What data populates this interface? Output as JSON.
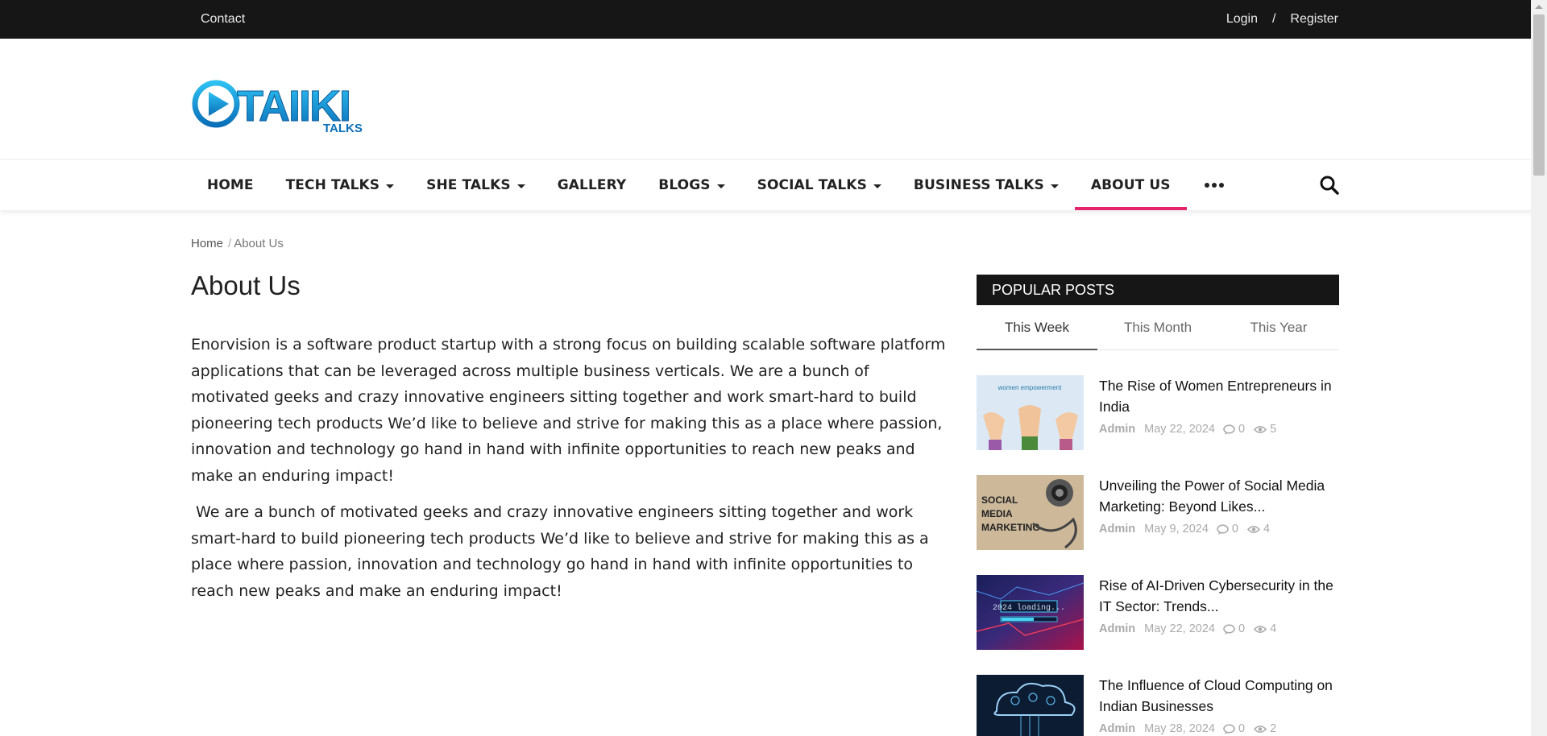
{
  "topbar": {
    "contact": "Contact",
    "login": "Login",
    "separator": "/",
    "register": "Register"
  },
  "logo": {
    "main_text": "TAIIKI",
    "sub_text": "TALKS"
  },
  "nav": {
    "items": [
      {
        "label": "HOME",
        "dropdown": false
      },
      {
        "label": "TECH TALKS",
        "dropdown": true
      },
      {
        "label": "SHE TALKS",
        "dropdown": true
      },
      {
        "label": "GALLERY",
        "dropdown": false
      },
      {
        "label": "BLOGS",
        "dropdown": true
      },
      {
        "label": "SOCIAL TALKS",
        "dropdown": true
      },
      {
        "label": "BUSINESS TALKS",
        "dropdown": true
      },
      {
        "label": "ABOUT US",
        "dropdown": false,
        "active": true
      }
    ],
    "accent_color": "#e6246e"
  },
  "breadcrumb": {
    "home": "Home",
    "separator": "/",
    "current": "About Us"
  },
  "page": {
    "title": "About Us",
    "paragraphs": [
      "Enorvision is a software product startup with a strong focus on building scalable software platform applications that can be leveraged across multiple business verticals. We are a bunch of motivated geeks and crazy innovative engineers sitting together and work smart-hard to build pioneering tech products We’d like to believe and strive for making this as a place where passion, innovation and technology go hand in hand with infinite opportunities to reach new peaks and make an enduring impact!",
      " We are a bunch of motivated geeks and crazy innovative engineers sitting together and work smart-hard to build pioneering tech products We’d like to believe and strive for making this as a place where passion, innovation and technology go hand in hand with infinite opportunities to reach new peaks and make an enduring impact!"
    ]
  },
  "sidebar": {
    "widget_title": "POPULAR POSTS",
    "tabs": [
      "This Week",
      "This Month",
      "This Year"
    ],
    "posts": [
      {
        "title": "The Rise of Women Entrepreneurs in India",
        "author": "Admin",
        "date": "May 22, 2024",
        "comments": "0",
        "views": "5",
        "thumb_text": "women empowerment"
      },
      {
        "title": "Unveiling the Power of Social Media Marketing: Beyond Likes...",
        "author": "Admin",
        "date": "May 9, 2024",
        "comments": "0",
        "views": "4",
        "thumb_text": "SOCIAL MEDIA MARKETING"
      },
      {
        "title": "Rise of AI-Driven Cybersecurity in the IT Sector: Trends...",
        "author": "Admin",
        "date": "May 22, 2024",
        "comments": "0",
        "views": "4",
        "thumb_text": "2024 loading..."
      },
      {
        "title": "The Influence of Cloud Computing on Indian Businesses",
        "author": "Admin",
        "date": "May 28, 2024",
        "comments": "0",
        "views": "2",
        "thumb_text": ""
      }
    ]
  }
}
